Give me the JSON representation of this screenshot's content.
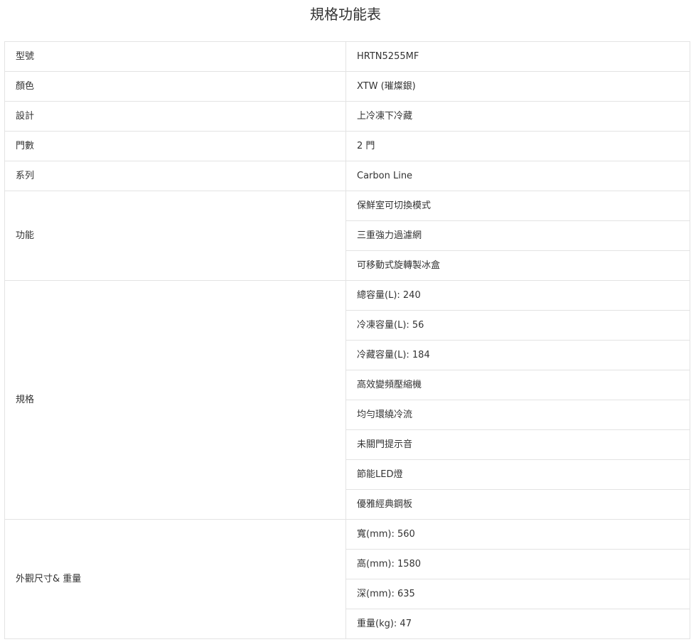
{
  "page": {
    "title": "規格功能表"
  },
  "spec_table": {
    "rows": [
      {
        "label": "型號",
        "values": [
          "HRTN5255MF"
        ]
      },
      {
        "label": "顏色",
        "values": [
          "XTW (璀燦銀)"
        ]
      },
      {
        "label": "設計",
        "values": [
          "上冷凍下冷藏"
        ]
      },
      {
        "label": "門數",
        "values": [
          "2 門"
        ]
      },
      {
        "label": "系列",
        "values": [
          "Carbon Line"
        ]
      },
      {
        "label": "功能",
        "values": [
          "保鮮室可切換模式",
          "三重強力過濾網",
          "可移動式旋轉製冰盒"
        ]
      },
      {
        "label": "規格",
        "values": [
          "總容量(L): 240",
          "冷凍容量(L): 56",
          "冷藏容量(L): 184",
          "高效變頻壓縮機",
          "均勻環繞冷流",
          "未關門提示音",
          "節能LED燈",
          "優雅經典鋼板"
        ]
      },
      {
        "label": "外觀尺寸& 重量",
        "values": [
          "寬(mm): 560",
          "高(mm): 1580",
          "深(mm): 635",
          "重量(kg): 47"
        ]
      }
    ]
  }
}
